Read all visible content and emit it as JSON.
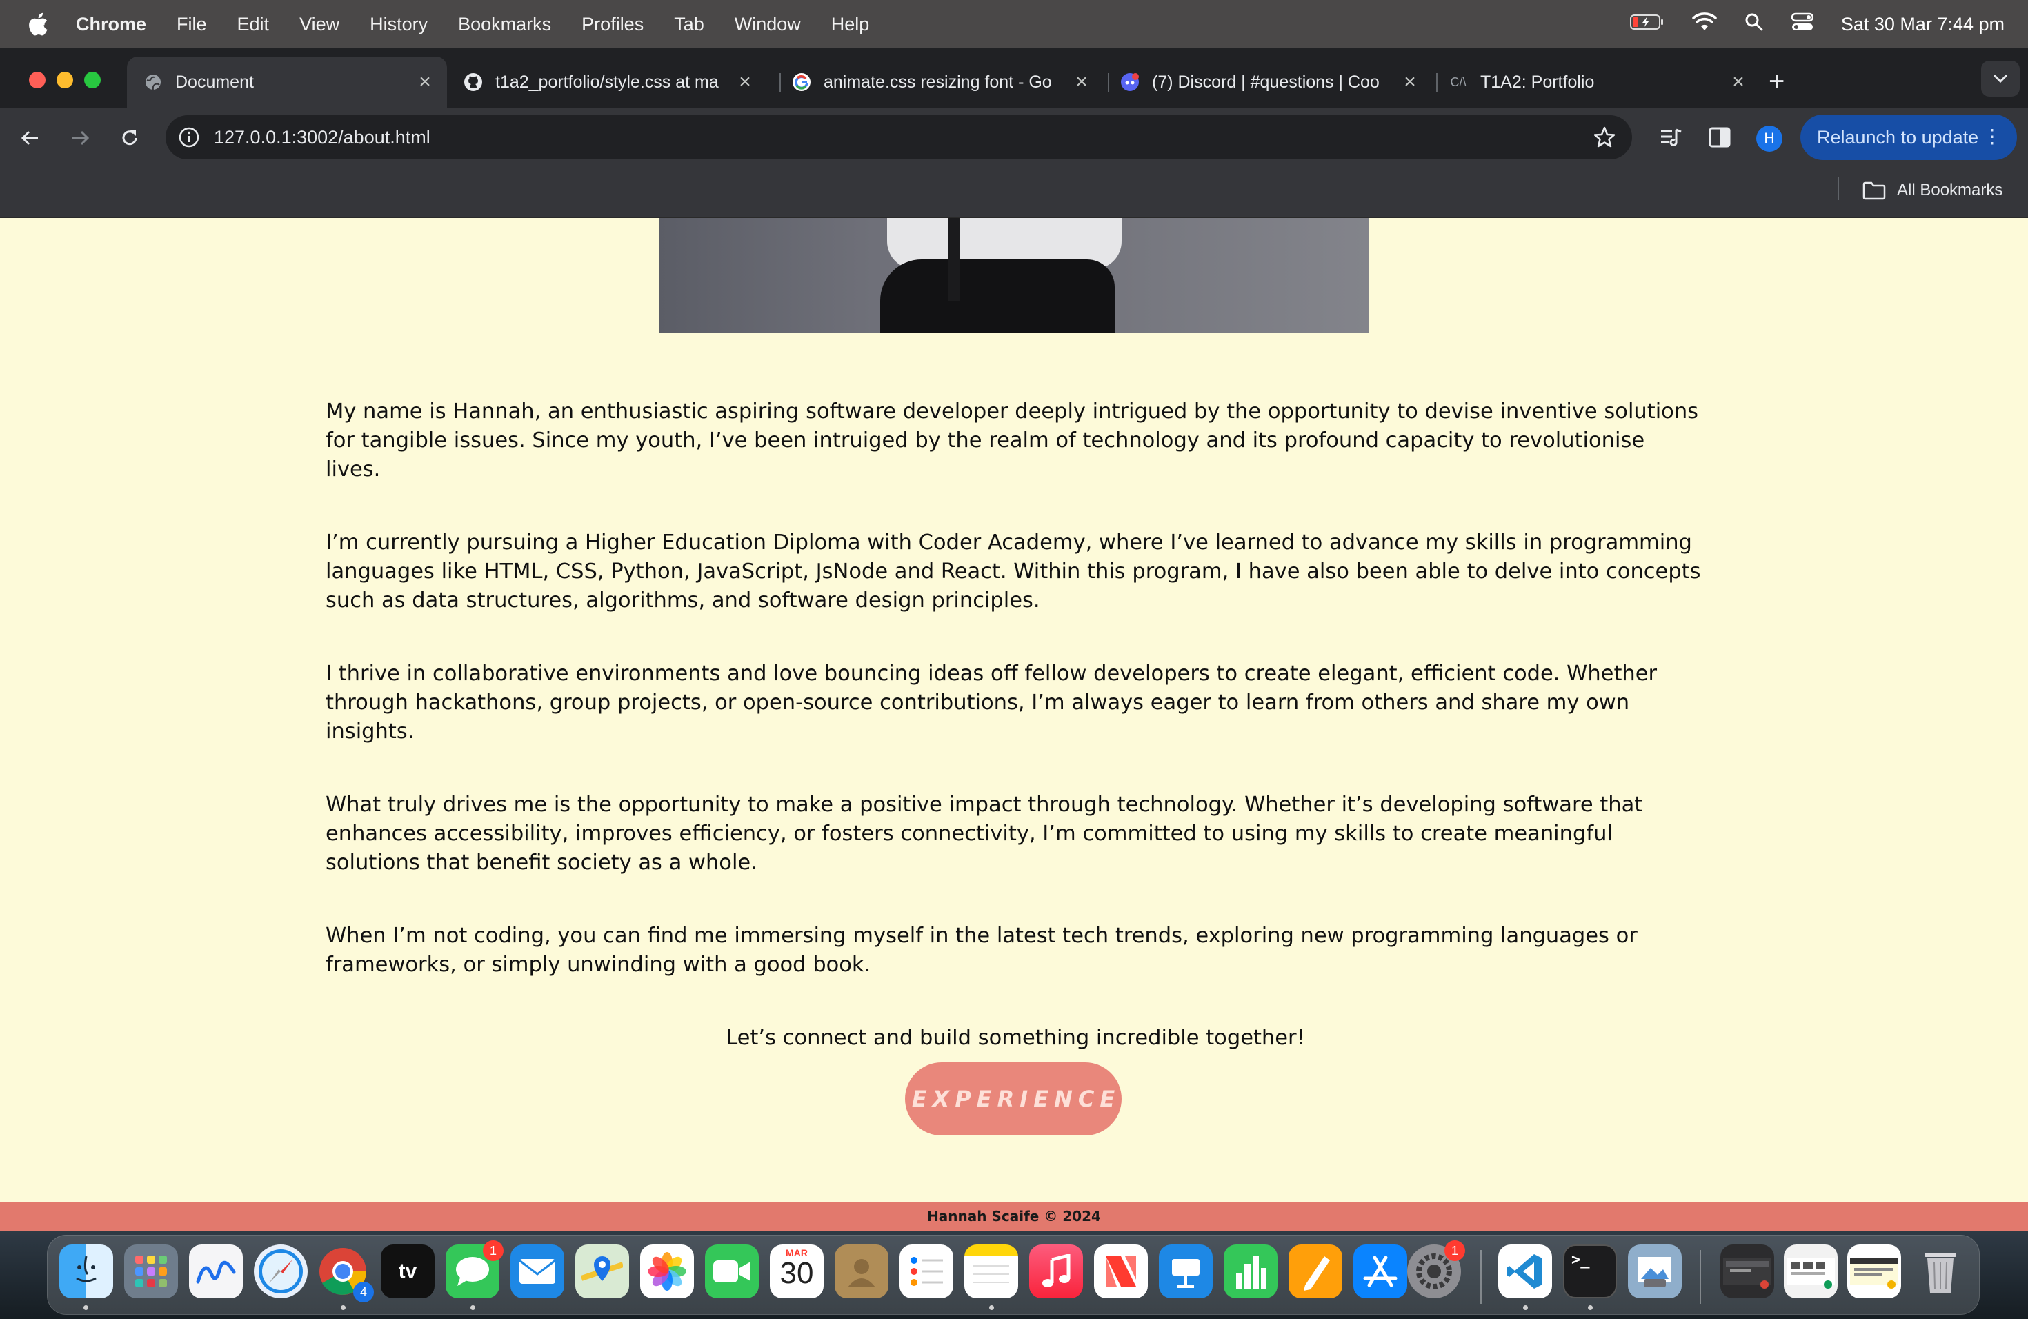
{
  "menubar": {
    "app_name": "Chrome",
    "items": [
      "File",
      "Edit",
      "View",
      "History",
      "Bookmarks",
      "Profiles",
      "Tab",
      "Window",
      "Help"
    ],
    "clock": "Sat 30 Mar  7:44 pm"
  },
  "tabs": [
    {
      "title": "Document",
      "icon": "globe-icon",
      "active": true
    },
    {
      "title": "t1a2_portfolio/style.css at ma",
      "icon": "github-icon",
      "active": false
    },
    {
      "title": "animate.css resizing font - Go",
      "icon": "google-icon",
      "active": false
    },
    {
      "title": "(7) Discord | #questions | Coo",
      "icon": "discord-icon",
      "active": false
    },
    {
      "title": "T1A2: Portfolio",
      "icon": "ca-icon",
      "active": false
    }
  ],
  "toolbar": {
    "url": "127.0.0.1:3002/about.html",
    "profile_initial": "H",
    "relaunch_label": "Relaunch to update"
  },
  "bookmarks": {
    "all_label": "All Bookmarks"
  },
  "about": {
    "paragraphs": [
      "My name is Hannah, an enthusiastic aspiring software developer deeply intrigued by the opportunity to devise inventive solutions for tangible issues. Since my youth, I’ve been intruiged by the realm of technology and its profound capacity to revolutionise lives.",
      "I’m currently pursuing a Higher Education Diploma with Coder Academy, where I’ve learned to advance my skills in programming languages like HTML, CSS, Python, JavaScript, JsNode and React. Within this program, I have also been able to delve into concepts such as data structures, algorithms, and software design principles.",
      "I thrive in collaborative environments and love bouncing ideas off fellow developers to create elegant, efficient code. Whether through hackathons, group projects, or open-source contributions, I’m always eager to learn from others and share my own insights.",
      "What truly drives me is the opportunity to make a positive impact through technology. Whether it’s developing software that enhances accessibility, improves efficiency, or fosters connectivity, I’m committed to using my skills to create meaningful solutions that benefit society as a whole.",
      "When I’m not coding, you can find me immersing myself in the latest tech trends, exploring new programming languages or frameworks, or simply unwinding with a good book."
    ],
    "closing": "Let’s connect and build something incredible together!",
    "button_label": "EXPERIENCE"
  },
  "footer": {
    "text": "Hannah Scaife © 2024"
  },
  "dock": {
    "calendar_month": "MAR",
    "calendar_day": "30",
    "chrome_badge": "4",
    "messages_badge": "1",
    "settings_badge": "1"
  },
  "colors": {
    "page_bg": "#fdfad9",
    "button_bg": "#e9877b",
    "footer_bg": "#e2796d",
    "relaunch_bg": "#174ea6"
  }
}
